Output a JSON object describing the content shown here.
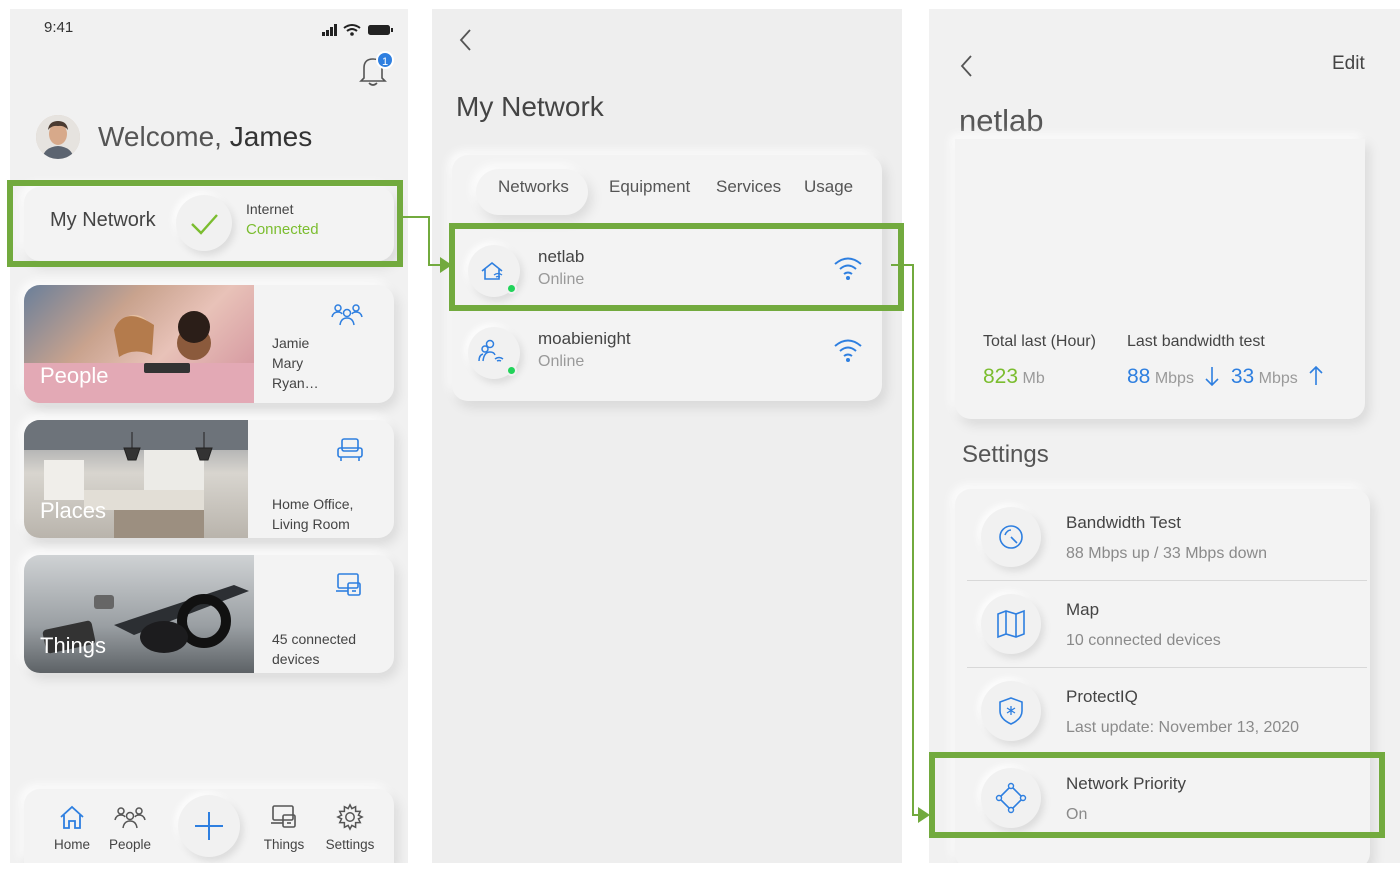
{
  "home": {
    "time": "9:41",
    "notif_count": "1",
    "welcome": "Welcome,",
    "user_name": "James",
    "my_network_label": "My Network",
    "internet_label": "Internet",
    "internet_status": "Connected",
    "cards": [
      {
        "title": "People",
        "text": "Jamie\nMary\nRyan…",
        "icon": "people-icon"
      },
      {
        "title": "Places",
        "text": "Home Office,\nLiving Room",
        "icon": "sofa-icon"
      },
      {
        "title": "Things",
        "text": "45 connected\ndevices",
        "icon": "devices-icon"
      }
    ],
    "nav": [
      {
        "label": "Home",
        "icon": "home-icon"
      },
      {
        "label": "People",
        "icon": "people-icon"
      },
      {
        "label": "Things",
        "icon": "devices-icon"
      },
      {
        "label": "Settings",
        "icon": "gear-icon"
      }
    ]
  },
  "network": {
    "title": "My Network",
    "tabs": [
      "Networks",
      "Equipment",
      "Services",
      "Usage"
    ],
    "active_tab": "Networks",
    "items": [
      {
        "name": "netlab",
        "status": "Online",
        "icon": "home-wifi-icon"
      },
      {
        "name": "moabienight",
        "status": "Online",
        "icon": "people-wifi-icon"
      }
    ]
  },
  "detail": {
    "edit_label": "Edit",
    "title": "netlab",
    "total_label": "Total last (Hour)",
    "total_value": "823",
    "total_unit": "Mb",
    "bw_label": "Last bandwidth test",
    "bw_down": "88",
    "bw_up": "33",
    "bw_unit": "Mbps",
    "settings_title": "Settings",
    "settings": [
      {
        "title": "Bandwidth Test",
        "sub": "88 Mbps up / 33 Mbps down",
        "icon": "speedometer-icon"
      },
      {
        "title": "Map",
        "sub": "10 connected devices",
        "icon": "map-icon"
      },
      {
        "title": "ProtectIQ",
        "sub": "Last update: November 13, 2020",
        "icon": "shield-icon"
      },
      {
        "title": "Network Priority",
        "sub": "On",
        "icon": "priority-icon"
      }
    ]
  },
  "colors": {
    "accent": "#2e7fe0",
    "success": "#7bbd2f",
    "highlight": "#72aa3e",
    "online_dot": "#22d35a"
  }
}
